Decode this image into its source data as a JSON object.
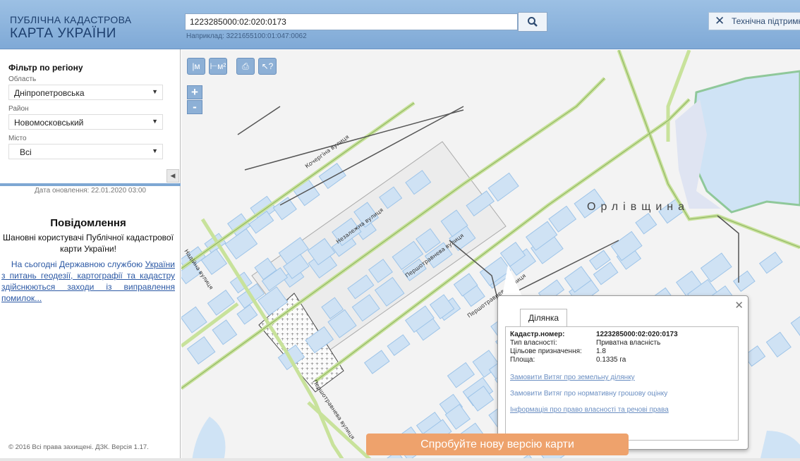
{
  "header": {
    "logo_line1": "ПУБЛІЧНА КАДАСТРОВА",
    "logo_line2": "КАРТА УКРАЇНИ",
    "search_value": "1223285000:02:020:0173",
    "search_hint": "Наприклад: 3221655100:01:047:0062",
    "support_label": "Технічна підтримка"
  },
  "sidebar": {
    "filter_title": "Фільтр по регіону",
    "oblast_label": "Область",
    "oblast_value": "Дніпропетровська",
    "rayon_label": "Район",
    "rayon_value": "Новомосковський",
    "misto_label": "Місто",
    "misto_value": "Всі",
    "updated": "Дата оновлення: 22.01.2020 03:00",
    "message_title": "Повідомлення",
    "message_text": "Шановні користувачі Публічної кадастрової карти України!",
    "message_lead": "На сьогодні Державною службою",
    "message_link": "України з питань геодезії, картографії та кадастру здійснюються заходи із виправлення помилок...",
    "copyright": "© 2016 Всі права захищені. ДЗК. Версія 1.17."
  },
  "map": {
    "toolbar": [
      {
        "name": "measure-distance-icon",
        "glyph": "|м"
      },
      {
        "name": "measure-area-icon",
        "glyph": "⊢м²"
      },
      {
        "name": "print-icon",
        "glyph": "⎙"
      },
      {
        "name": "info-cursor-icon",
        "glyph": "↖?"
      }
    ],
    "zoom_in": "+",
    "zoom_out": "-",
    "place_label": "Орлівщина",
    "street_labels": [
      "Кочергіна вулиця",
      "Незалежна вулиця",
      "Першотравнева вулиця",
      "Першотравнева вулиця",
      "Надійна вулиця",
      "Першотравнева вулиця"
    ]
  },
  "popup": {
    "tab": "Ділянка",
    "rows": [
      {
        "label": "Кадастр.номер:",
        "value": "1223285000:02:020:0173"
      },
      {
        "label": "Тип власності:",
        "value": "Приватна власність"
      },
      {
        "label": "Цільове призначення:",
        "value": "1.8"
      },
      {
        "label": "Площа:",
        "value": "0.1335 га"
      }
    ],
    "links": [
      "Замовити Витяг про земельну ділянку",
      "Замовити Витяг про нормативну грошову оцінку",
      "Інформація про право власності та речові права"
    ]
  },
  "banner": "Спробуйте нову версію карти",
  "colors": {
    "header": "#8fb6df",
    "parcel_fill": "#cfe2f4",
    "parcel_stroke": "#9ec4e8",
    "road": "#c8e29b",
    "water": "#cfe3f5",
    "banner": "#eea26c"
  }
}
